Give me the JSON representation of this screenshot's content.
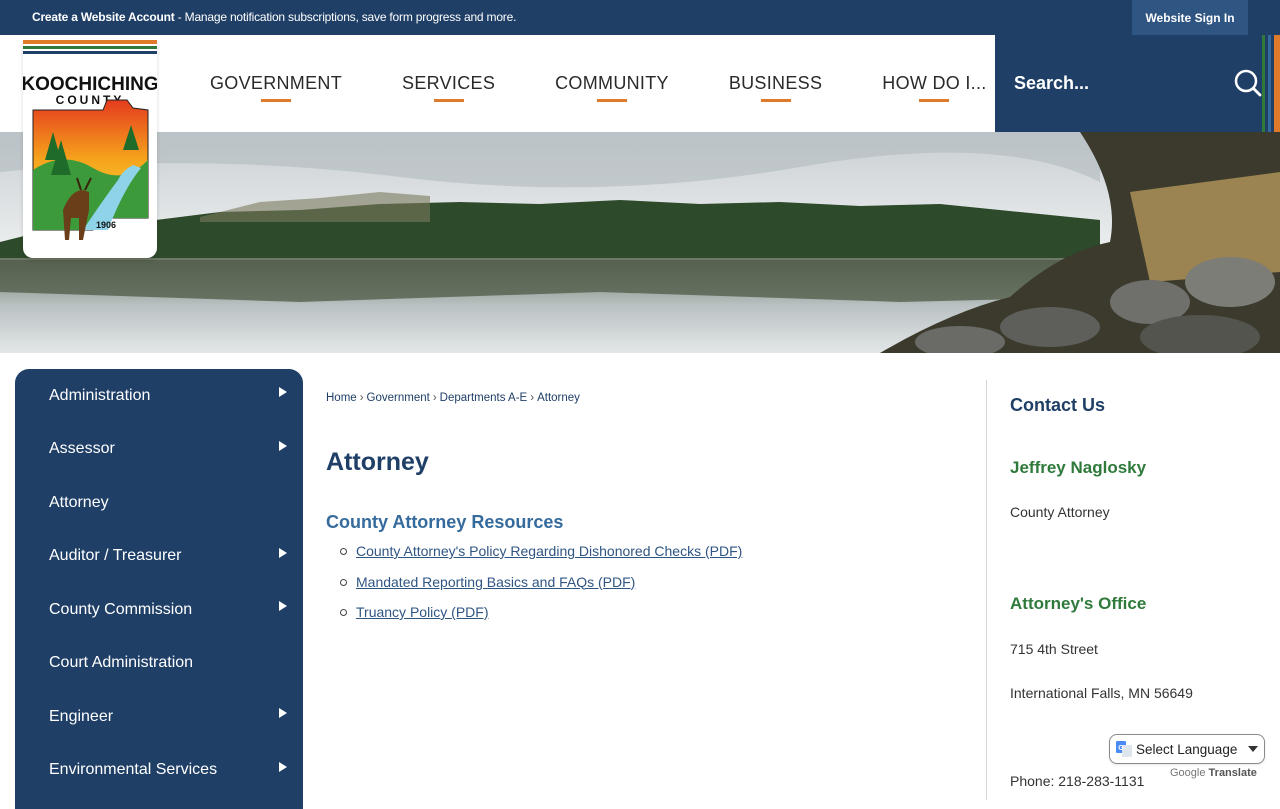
{
  "topbar": {
    "account_link_bold": "Create a Website Account",
    "account_link_rest": " - Manage notification subscriptions, save form progress and more.",
    "signin_label": "Website Sign In"
  },
  "logo": {
    "line1": "KOOCHICHING",
    "line2": "COUNTY",
    "year": "1906"
  },
  "nav": {
    "items": [
      "GOVERNMENT",
      "SERVICES",
      "COMMUNITY",
      "BUSINESS",
      "HOW DO I..."
    ]
  },
  "search": {
    "placeholder": "Search..."
  },
  "sidenav": {
    "items": [
      {
        "label": "Administration",
        "has_sub": true
      },
      {
        "label": "Assessor",
        "has_sub": true
      },
      {
        "label": "Attorney",
        "has_sub": false
      },
      {
        "label": "Auditor / Treasurer",
        "has_sub": true
      },
      {
        "label": "County Commission",
        "has_sub": true
      },
      {
        "label": "Court Administration",
        "has_sub": false
      },
      {
        "label": "Engineer",
        "has_sub": true
      },
      {
        "label": "Environmental Services",
        "has_sub": true
      }
    ]
  },
  "breadcrumb": {
    "items": [
      "Home",
      "Government",
      "Departments A-E",
      "Attorney"
    ],
    "separator": "›"
  },
  "main": {
    "title": "Attorney",
    "resources_heading": "County Attorney Resources",
    "links": [
      "County Attorney's Policy Regarding Dishonored Checks (PDF)",
      "Mandated Reporting Basics and FAQs (PDF)",
      "Truancy Policy (PDF)"
    ]
  },
  "contact": {
    "title": "Contact Us",
    "name": "Jeffrey Naglosky",
    "role": "County Attorney",
    "office_title": "Attorney's Office",
    "address_line1": "715 4th Street",
    "address_line2": "International Falls, MN 56649",
    "phone": "Phone: 218-283-1131"
  },
  "translate": {
    "select_label": "Select Language",
    "powered_by_brand": "Google",
    "powered_by_word": "Translate"
  },
  "colors": {
    "navy": "#1f3f67",
    "accent_orange": "#e07a2b",
    "green_heading": "#2f7a3b",
    "link_blue": "#2f5583"
  }
}
